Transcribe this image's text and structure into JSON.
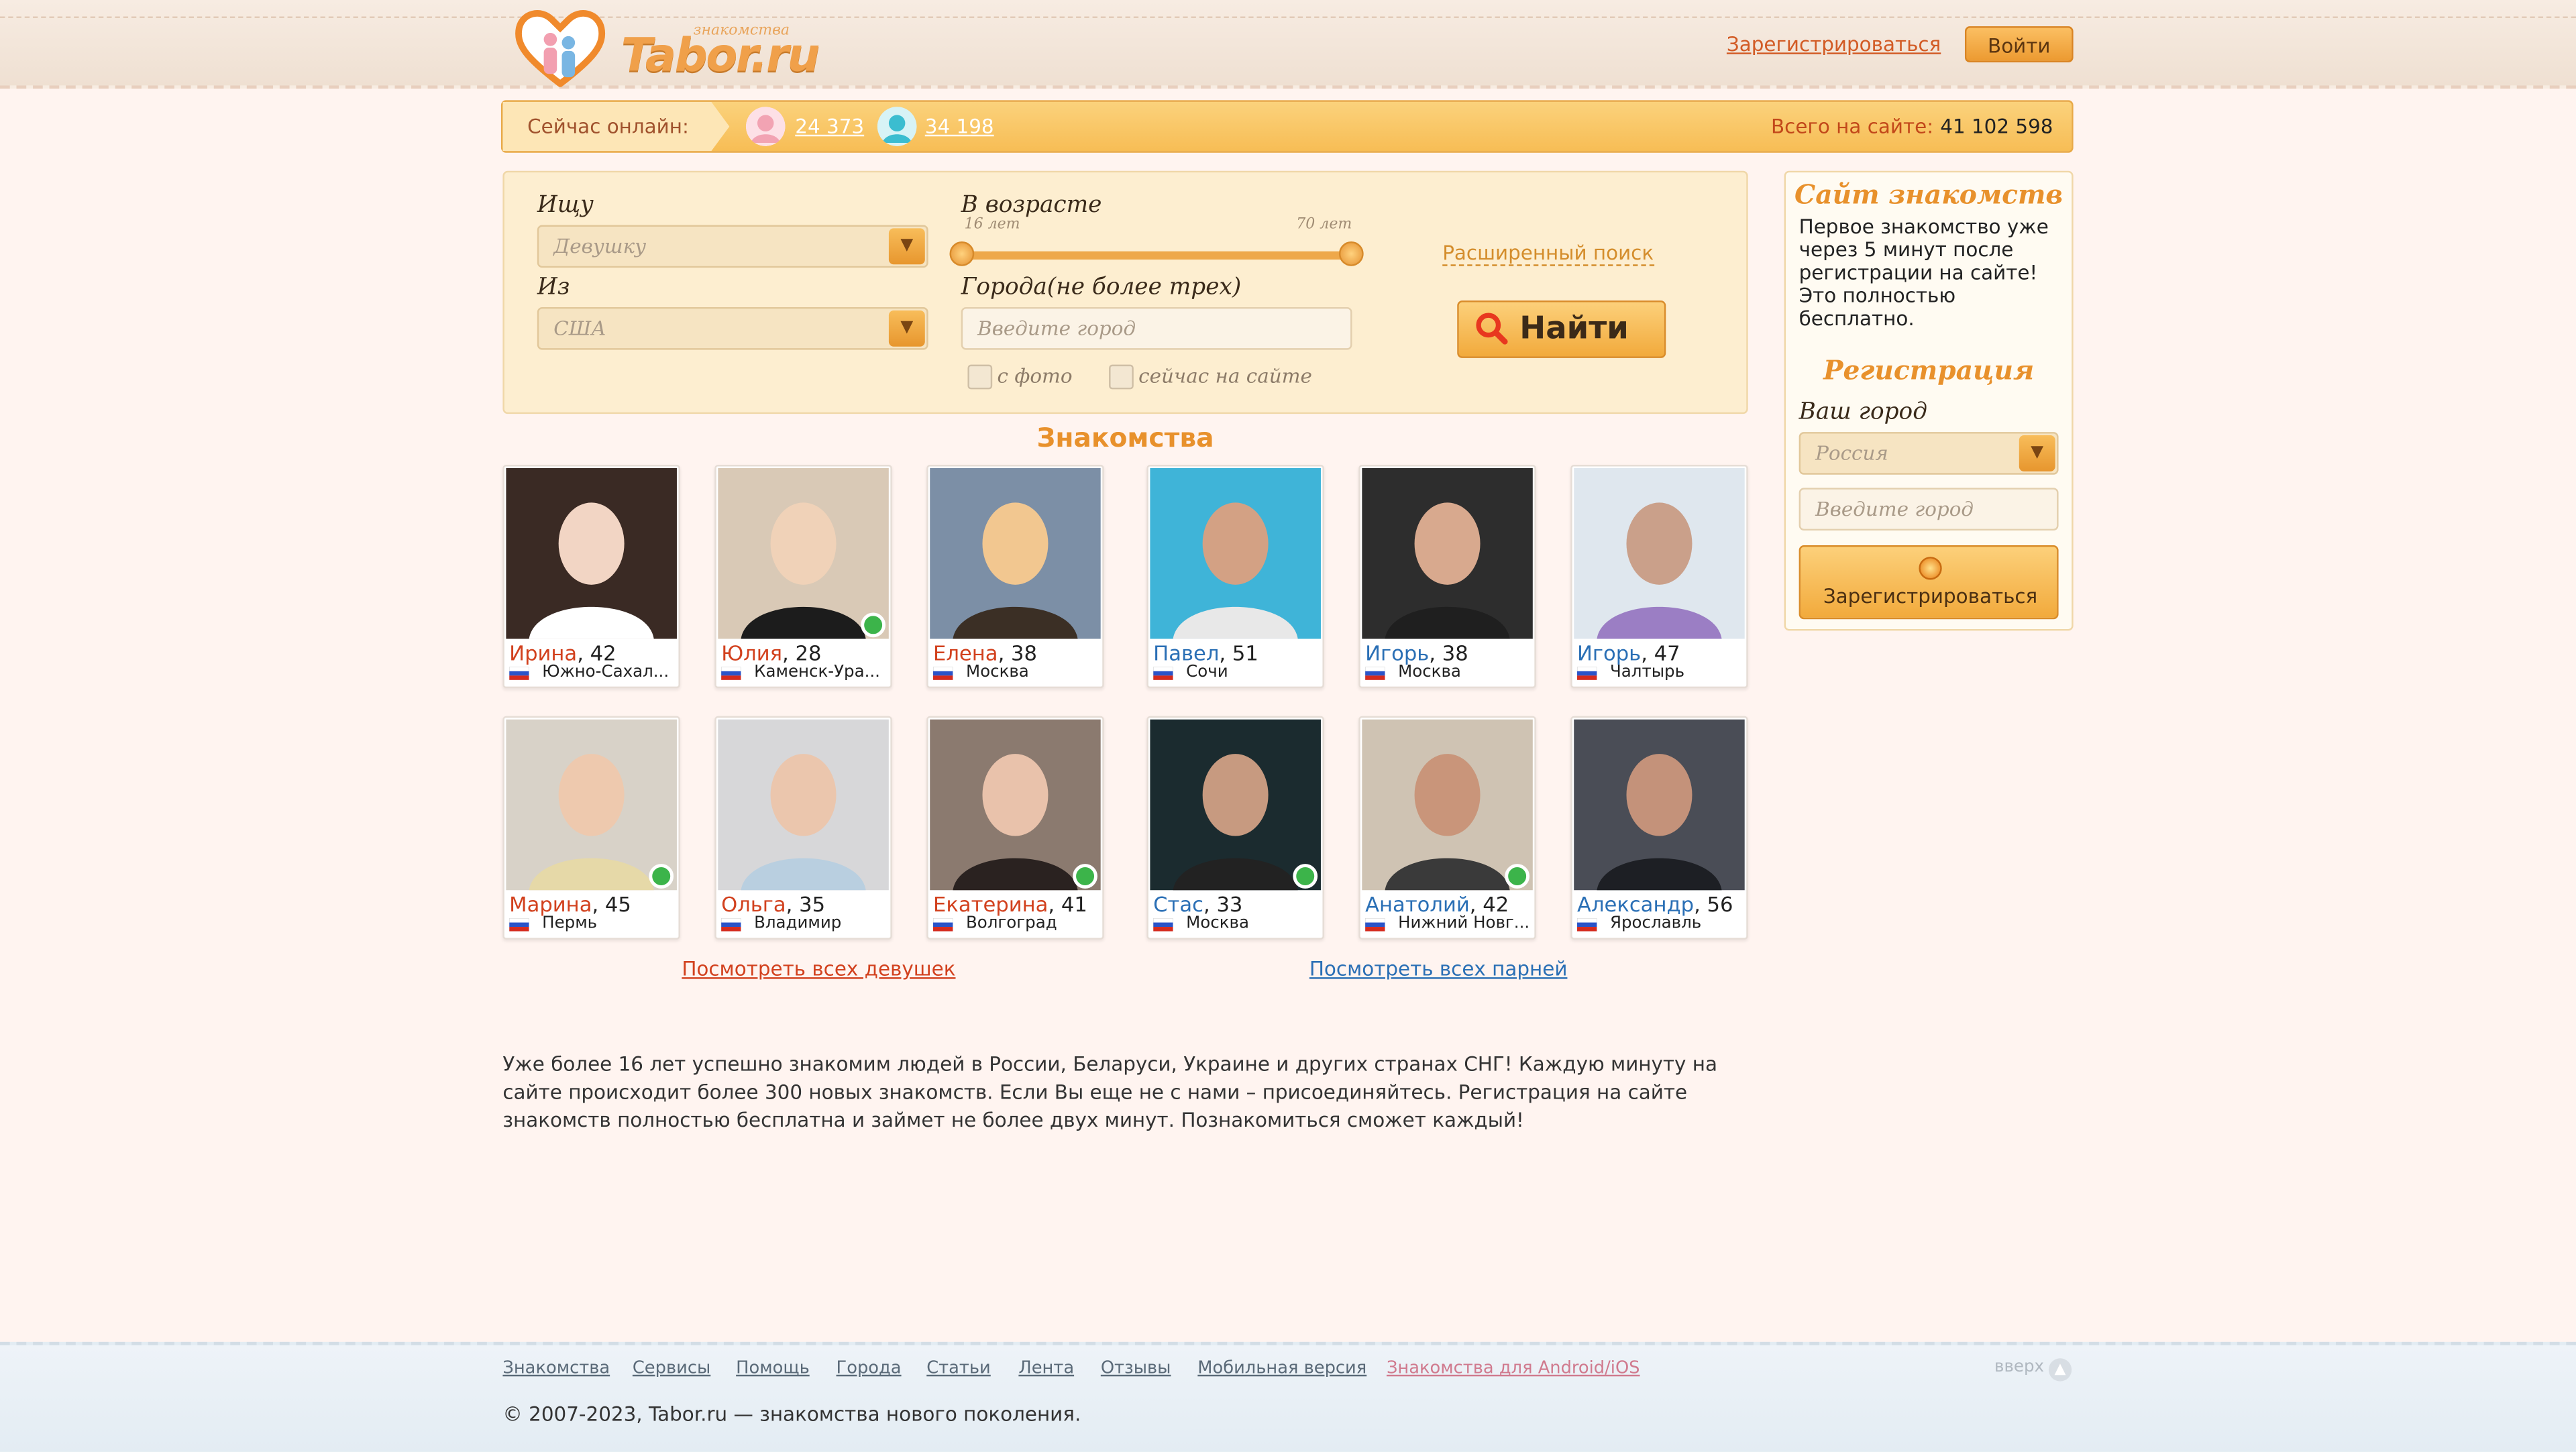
{
  "header": {
    "logo_small": "знакомства",
    "logo_text": "Tabor.ru",
    "register_link": "Зарегистрироваться",
    "login_button": "Войти"
  },
  "online": {
    "label": "Сейчас онлайн:",
    "women_count": "24 373",
    "men_count": "34 198",
    "total_label": "Всего на сайте:",
    "total_value": "41 102 598"
  },
  "search": {
    "seek_label": "Ищу",
    "seek_value": "Девушку",
    "from_label": "Из",
    "from_value": "США",
    "age_label": "В возрасте",
    "age_min": "16 лет",
    "age_max": "70 лет",
    "cities_label": "Города(не более трех)",
    "city_placeholder": "Введите город",
    "with_photo": "с фото",
    "online_now": "сейчас на сайте",
    "advanced_link": "Расширенный поиск",
    "find_button": "Найти"
  },
  "sidebar": {
    "title": "Сайт знакомств",
    "text": "Первое знакомство уже через 5 минут после регистрации на сайте! Это полностью бесплатно.",
    "reg_title": "Регистрация",
    "city_label": "Ваш город",
    "country_value": "Россия",
    "city_placeholder": "Введите город",
    "register_button": "Зарегистрироваться"
  },
  "section_title": "Знакомства",
  "profiles": [
    {
      "name": "Ирина",
      "age": ", 42",
      "city": "Южно-Сахал...",
      "gender": "f",
      "online": false
    },
    {
      "name": "Юлия",
      "age": ", 28",
      "city": "Каменск-Ура...",
      "gender": "f",
      "online": true
    },
    {
      "name": "Елена",
      "age": ", 38",
      "city": "Москва",
      "gender": "f",
      "online": false
    },
    {
      "name": "Павел",
      "age": ", 51",
      "city": "Сочи",
      "gender": "m",
      "online": false
    },
    {
      "name": "Игорь",
      "age": ", 38",
      "city": "Москва",
      "gender": "m",
      "online": false
    },
    {
      "name": "Игорь",
      "age": ", 47",
      "city": "Чалтырь",
      "gender": "m",
      "online": false
    },
    {
      "name": "Марина",
      "age": ", 45",
      "city": "Пермь",
      "gender": "f",
      "online": true
    },
    {
      "name": "Ольга",
      "age": ", 35",
      "city": "Владимир",
      "gender": "f",
      "online": false
    },
    {
      "name": "Екатерина",
      "age": ", 41",
      "city": "Волгоград",
      "gender": "f",
      "online": true
    },
    {
      "name": "Стас",
      "age": ", 33",
      "city": "Москва",
      "gender": "m",
      "online": true
    },
    {
      "name": "Анатолий",
      "age": ", 42",
      "city": "Нижний Новг...",
      "gender": "m",
      "online": true
    },
    {
      "name": "Александр",
      "age": ", 56",
      "city": "Ярославль",
      "gender": "m",
      "online": false
    }
  ],
  "see_all_women": "Посмотреть всех девушек",
  "see_all_men": "Посмотреть всех парней",
  "about": "Уже более 16 лет успешно знакомим людей в России, Беларуси, Украине и других странах СНГ! Каждую минуту на сайте происходит более 300 новых знакомств. Если Вы еще не с нами – присоединяйтесь. Регистрация на сайте знакомств полностью бесплатна и займет не более двух минут. Познакомиться сможет каждый!",
  "footer": {
    "links": [
      "Знакомства",
      "Сервисы",
      "Помощь",
      "Города",
      "Статьи",
      "Лента",
      "Отзывы",
      "Мобильная версия",
      "Знакомства для Android/iOS"
    ],
    "up": "вверх",
    "copyright": "© 2007-2023, Tabor.ru — знакомства нового поколения."
  },
  "colors": {
    "accent": "#f0a04a",
    "female_name": "#d2411e",
    "male_name": "#2a6fb5",
    "online": "#3cb44a"
  }
}
